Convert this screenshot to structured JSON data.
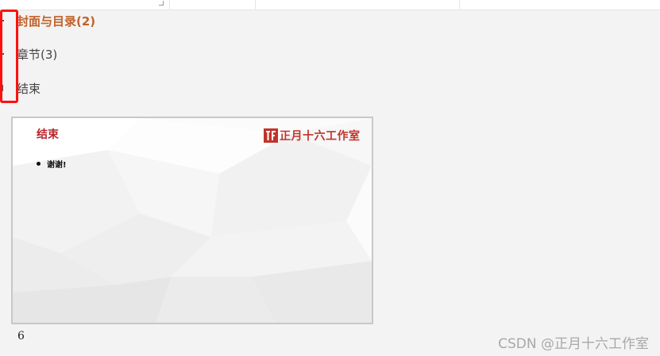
{
  "outline": {
    "sections": [
      {
        "label": "封面与目录(2)",
        "active": true
      },
      {
        "label": "章节(3)",
        "active": false
      },
      {
        "label": "结束",
        "active": false
      }
    ]
  },
  "slide": {
    "number": "6",
    "title": "结束",
    "brand_text": "正月十六工作室",
    "bullets": [
      "谢谢!"
    ]
  },
  "watermark": "CSDN @正月十六工作室",
  "colors": {
    "active_section": "#c0622b",
    "highlight_box": "#ff1010",
    "slide_title": "#b8252b",
    "brand": "#c0332a"
  }
}
